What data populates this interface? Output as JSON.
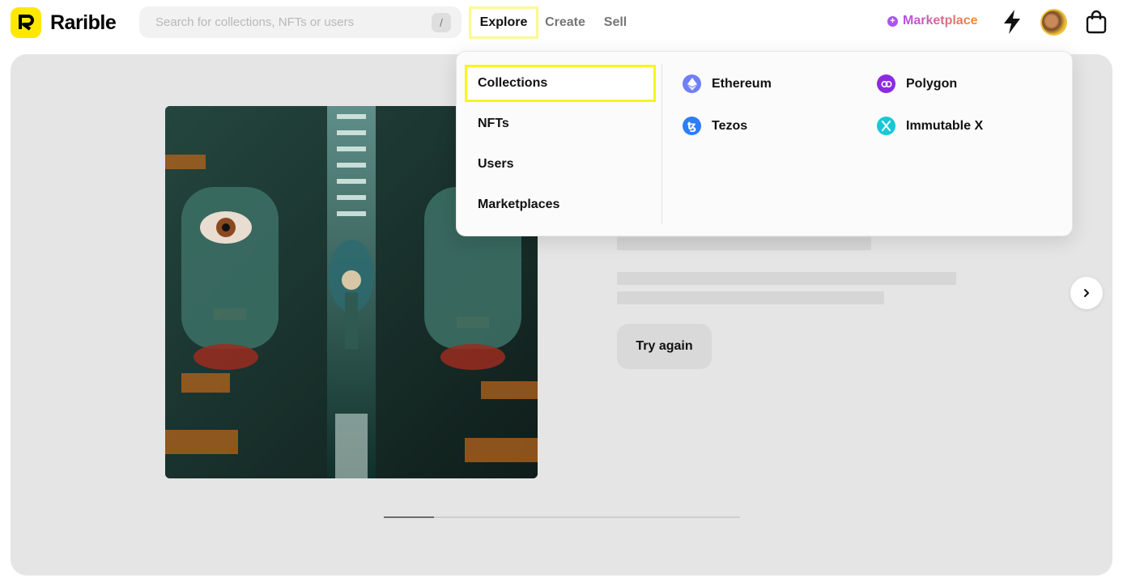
{
  "brand": {
    "name": "Rarible",
    "logo_letter": "R",
    "color": "#fee801"
  },
  "search": {
    "placeholder": "Search for collections, NFTs or users",
    "shortcut": "/"
  },
  "nav": {
    "explore": "Explore",
    "create": "Create",
    "sell": "Sell"
  },
  "marketplace": {
    "label": "Marketplace",
    "icon": "plus-circle-icon"
  },
  "header_icons": [
    "bolt-icon",
    "avatar",
    "shopping-bag-icon"
  ],
  "hero": {
    "try_again": "Try again",
    "next_icon": "chevron-right-icon",
    "carousel_progress_fraction": 0.14
  },
  "explore_menu": {
    "items": [
      {
        "label": "Collections",
        "active": true
      },
      {
        "label": "NFTs",
        "active": false
      },
      {
        "label": "Users",
        "active": false
      },
      {
        "label": "Marketplaces",
        "active": false
      }
    ],
    "chains": [
      {
        "label": "Ethereum",
        "icon": "ethereum-icon",
        "color": "#6f7ff5"
      },
      {
        "label": "Polygon",
        "icon": "polygon-icon",
        "color": "#8a2be2"
      },
      {
        "label": "Tezos",
        "icon": "tezos-icon",
        "color": "#2c7df7"
      },
      {
        "label": "Immutable X",
        "icon": "immutable-x-icon",
        "color": "#18c8d6"
      }
    ]
  }
}
